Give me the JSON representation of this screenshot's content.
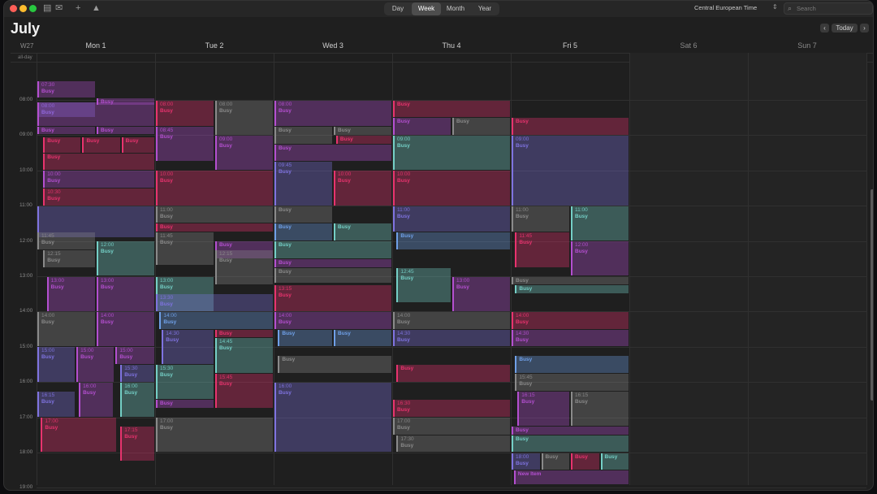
{
  "toolbar": {
    "views": [
      "Day",
      "Week",
      "Month",
      "Year"
    ],
    "selected_view": "Week",
    "timezone": "Central European Time",
    "search_placeholder": "Search"
  },
  "header": {
    "month": "July",
    "week_label": "W27",
    "today_label": "Today",
    "allday_label": "all-day",
    "days": [
      "Mon 1",
      "Tue 2",
      "Wed 3",
      "Thu 4",
      "Fri 5",
      "Sat 6",
      "Sun 7"
    ]
  },
  "hours": [
    "08:00",
    "09:00",
    "10:00",
    "11:00",
    "12:00",
    "13:00",
    "14:00",
    "15:00",
    "16:00",
    "17:00",
    "18:00",
    "19:00"
  ],
  "colors": {
    "purple": "#b44fd0",
    "pink": "#e8336e",
    "gray": "#8a8a8a",
    "lavender": "#7f73e0",
    "teal": "#74cfc6",
    "blue": "#6fa0e8"
  },
  "events": [
    {
      "col": 0,
      "x": 0,
      "w": 0.5,
      "s": 7.45,
      "e": 7.95,
      "c": "purple",
      "time": "07:30",
      "label": "Busy"
    },
    {
      "col": 0,
      "x": 0.5,
      "w": 0.5,
      "s": 7.95,
      "e": 8.15,
      "c": "purple",
      "time": "",
      "label": "Busy"
    },
    {
      "col": 0,
      "x": 0,
      "w": 0.5,
      "s": 8.05,
      "e": 8.5,
      "c": "lavender",
      "time": "08:00",
      "label": "Busy"
    },
    {
      "col": 0,
      "x": 0,
      "w": 1,
      "s": 8.05,
      "e": 8.75,
      "c": "purple",
      "time": "",
      "label": ""
    },
    {
      "col": 0,
      "x": 0,
      "w": 0.5,
      "s": 8.75,
      "e": 8.98,
      "c": "purple",
      "time": "",
      "label": "Busy"
    },
    {
      "col": 0,
      "x": 0.5,
      "w": 0.5,
      "s": 8.75,
      "e": 8.98,
      "c": "purple",
      "time": "",
      "label": "Busy"
    },
    {
      "col": 0,
      "x": 0.05,
      "w": 0.33,
      "s": 9.05,
      "e": 9.5,
      "c": "pink",
      "time": "",
      "label": "Busy"
    },
    {
      "col": 0,
      "x": 0.38,
      "w": 0.33,
      "s": 9.05,
      "e": 9.5,
      "c": "pink",
      "time": "",
      "label": "Busy"
    },
    {
      "col": 0,
      "x": 0.71,
      "w": 0.29,
      "s": 9.05,
      "e": 9.5,
      "c": "pink",
      "time": "",
      "label": "Busy"
    },
    {
      "col": 0,
      "x": 0.05,
      "w": 0.95,
      "s": 9.5,
      "e": 10.0,
      "c": "pink",
      "time": "",
      "label": "Busy"
    },
    {
      "col": 0,
      "x": 0.05,
      "w": 0.95,
      "s": 10.0,
      "e": 10.5,
      "c": "purple",
      "time": "10:00",
      "label": "Busy"
    },
    {
      "col": 0,
      "x": 0.05,
      "w": 0.95,
      "s": 10.5,
      "e": 11.0,
      "c": "pink",
      "time": "10:30",
      "label": "Busy"
    },
    {
      "col": 0,
      "x": 0,
      "w": 1,
      "s": 11.0,
      "e": 11.9,
      "c": "lavender",
      "time": "",
      "label": ""
    },
    {
      "col": 0,
      "x": 0,
      "w": 0.5,
      "s": 11.75,
      "e": 12.25,
      "c": "gray",
      "time": "11:45",
      "label": "Busy"
    },
    {
      "col": 0,
      "x": 0.05,
      "w": 0.45,
      "s": 12.25,
      "e": 12.75,
      "c": "gray",
      "time": "12:15",
      "label": "Busy"
    },
    {
      "col": 0,
      "x": 0.5,
      "w": 0.5,
      "s": 12.0,
      "e": 13.0,
      "c": "teal",
      "time": "12:00",
      "label": "Busy"
    },
    {
      "col": 0,
      "x": 0.08,
      "w": 0.42,
      "s": 13.0,
      "e": 14.0,
      "c": "purple",
      "time": "13:00",
      "label": "Busy"
    },
    {
      "col": 0,
      "x": 0.5,
      "w": 0.5,
      "s": 13.0,
      "e": 14.0,
      "c": "purple",
      "time": "13:00",
      "label": "Busy"
    },
    {
      "col": 0,
      "x": 0,
      "w": 0.5,
      "s": 14.0,
      "e": 15.0,
      "c": "gray",
      "time": "14:00",
      "label": "Busy"
    },
    {
      "col": 0,
      "x": 0.5,
      "w": 0.5,
      "s": 14.0,
      "e": 15.0,
      "c": "purple",
      "time": "14:00",
      "label": "Busy"
    },
    {
      "col": 0,
      "x": 0,
      "w": 0.33,
      "s": 15.0,
      "e": 16.0,
      "c": "lavender",
      "time": "15:00",
      "label": "Busy"
    },
    {
      "col": 0,
      "x": 0.33,
      "w": 0.33,
      "s": 15.0,
      "e": 16.0,
      "c": "purple",
      "time": "15:00",
      "label": "Busy"
    },
    {
      "col": 0,
      "x": 0.66,
      "w": 0.34,
      "s": 15.0,
      "e": 15.5,
      "c": "purple",
      "time": "15:00",
      "label": "Busy"
    },
    {
      "col": 0,
      "x": 0.7,
      "w": 0.3,
      "s": 15.5,
      "e": 16.0,
      "c": "lavender",
      "time": "15:30",
      "label": "Busy"
    },
    {
      "col": 0,
      "x": 0,
      "w": 0.33,
      "s": 16.25,
      "e": 17.0,
      "c": "lavender",
      "time": "16:15",
      "label": "Busy"
    },
    {
      "col": 0,
      "x": 0.35,
      "w": 0.3,
      "s": 16.0,
      "e": 17.0,
      "c": "purple",
      "time": "16:00",
      "label": "Busy"
    },
    {
      "col": 0,
      "x": 0.7,
      "w": 0.3,
      "s": 16.0,
      "e": 17.0,
      "c": "teal",
      "time": "16:00",
      "label": "Busy"
    },
    {
      "col": 0,
      "x": 0.03,
      "w": 0.65,
      "s": 17.0,
      "e": 18.0,
      "c": "pink",
      "time": "17:00",
      "label": "Busy"
    },
    {
      "col": 0,
      "x": 0.7,
      "w": 0.3,
      "s": 17.25,
      "e": 18.25,
      "c": "pink",
      "time": "17:15",
      "label": "Busy"
    },
    {
      "col": 1,
      "x": 0,
      "w": 0.5,
      "s": 8.0,
      "e": 8.75,
      "c": "pink",
      "time": "08:00",
      "label": "Busy"
    },
    {
      "col": 1,
      "x": 0.5,
      "w": 0.5,
      "s": 8.0,
      "e": 9.0,
      "c": "gray",
      "time": "08:00",
      "label": "Busy"
    },
    {
      "col": 1,
      "x": 0,
      "w": 0.5,
      "s": 8.75,
      "e": 9.75,
      "c": "purple",
      "time": "08:45",
      "label": "Busy"
    },
    {
      "col": 1,
      "x": 0.5,
      "w": 0.5,
      "s": 9.0,
      "e": 10.0,
      "c": "purple",
      "time": "09:00",
      "label": "Busy"
    },
    {
      "col": 1,
      "x": 0,
      "w": 1,
      "s": 10.0,
      "e": 11.0,
      "c": "pink",
      "time": "10:00",
      "label": "Busy"
    },
    {
      "col": 1,
      "x": 0,
      "w": 1,
      "s": 11.0,
      "e": 11.5,
      "c": "gray",
      "time": "11:00",
      "label": "Busy"
    },
    {
      "col": 1,
      "x": 0,
      "w": 1,
      "s": 11.5,
      "e": 11.75,
      "c": "pink",
      "time": "",
      "label": "Busy"
    },
    {
      "col": 1,
      "x": 0,
      "w": 0.5,
      "s": 11.75,
      "e": 12.7,
      "c": "gray",
      "time": "11:45",
      "label": "Busy"
    },
    {
      "col": 1,
      "x": 0.5,
      "w": 0.5,
      "s": 12.0,
      "e": 12.5,
      "c": "purple",
      "time": "",
      "label": "Busy"
    },
    {
      "col": 1,
      "x": 0.5,
      "w": 0.5,
      "s": 12.25,
      "e": 13.25,
      "c": "gray",
      "time": "12:15",
      "label": "Busy"
    },
    {
      "col": 1,
      "x": 0,
      "w": 0.5,
      "s": 13.0,
      "e": 14.0,
      "c": "teal",
      "time": "13:00",
      "label": "Busy"
    },
    {
      "col": 1,
      "x": 0,
      "w": 1,
      "s": 13.5,
      "e": 14.0,
      "c": "lavender",
      "time": "13:30",
      "label": "Busy"
    },
    {
      "col": 1,
      "x": 0.03,
      "w": 0.97,
      "s": 14.0,
      "e": 14.5,
      "c": "blue",
      "time": "14:00",
      "label": "Busy"
    },
    {
      "col": 1,
      "x": 0.05,
      "w": 0.45,
      "s": 14.5,
      "e": 15.5,
      "c": "lavender",
      "time": "14:30",
      "label": "Busy"
    },
    {
      "col": 1,
      "x": 0.5,
      "w": 0.5,
      "s": 14.5,
      "e": 14.75,
      "c": "pink",
      "time": "",
      "label": "Busy"
    },
    {
      "col": 1,
      "x": 0.5,
      "w": 0.5,
      "s": 14.75,
      "e": 15.75,
      "c": "teal",
      "time": "14:45",
      "label": "Busy"
    },
    {
      "col": 1,
      "x": 0,
      "w": 0.5,
      "s": 15.5,
      "e": 16.5,
      "c": "teal",
      "time": "15:30",
      "label": "Busy"
    },
    {
      "col": 1,
      "x": 0.5,
      "w": 0.5,
      "s": 15.75,
      "e": 16.75,
      "c": "pink",
      "time": "15:45",
      "label": "Busy"
    },
    {
      "col": 1,
      "x": 0,
      "w": 0.5,
      "s": 16.5,
      "e": 16.75,
      "c": "purple",
      "time": "",
      "label": "Busy"
    },
    {
      "col": 1,
      "x": 0,
      "w": 1,
      "s": 17.0,
      "e": 18.0,
      "c": "gray",
      "time": "17:00",
      "label": "Busy"
    },
    {
      "col": 2,
      "x": 0,
      "w": 1,
      "s": 8.0,
      "e": 8.75,
      "c": "purple",
      "time": "08:00",
      "label": "Busy"
    },
    {
      "col": 2,
      "x": 0,
      "w": 0.5,
      "s": 8.75,
      "e": 9.25,
      "c": "gray",
      "time": "",
      "label": "Busy"
    },
    {
      "col": 2,
      "x": 0.5,
      "w": 0.5,
      "s": 8.75,
      "e": 9.0,
      "c": "gray",
      "time": "",
      "label": "Busy"
    },
    {
      "col": 2,
      "x": 0.52,
      "w": 0.48,
      "s": 9.0,
      "e": 9.25,
      "c": "pink",
      "time": "",
      "label": "Busy"
    },
    {
      "col": 2,
      "x": 0,
      "w": 1,
      "s": 9.25,
      "e": 9.75,
      "c": "purple",
      "time": "",
      "label": "Busy"
    },
    {
      "col": 2,
      "x": 0,
      "w": 0.5,
      "s": 9.75,
      "e": 11.0,
      "c": "lavender",
      "time": "09:45",
      "label": "Busy"
    },
    {
      "col": 2,
      "x": 0.5,
      "w": 0.5,
      "s": 10.0,
      "e": 11.0,
      "c": "pink",
      "time": "10:00",
      "label": "Busy"
    },
    {
      "col": 2,
      "x": 0,
      "w": 0.5,
      "s": 11.0,
      "e": 11.5,
      "c": "gray",
      "time": "",
      "label": "Busy"
    },
    {
      "col": 2,
      "x": 0,
      "w": 0.5,
      "s": 11.5,
      "e": 12.0,
      "c": "blue",
      "time": "",
      "label": "Busy"
    },
    {
      "col": 2,
      "x": 0.5,
      "w": 0.5,
      "s": 11.5,
      "e": 12.0,
      "c": "teal",
      "time": "",
      "label": "Busy"
    },
    {
      "col": 2,
      "x": 0,
      "w": 1,
      "s": 12.0,
      "e": 12.5,
      "c": "teal",
      "time": "",
      "label": "Busy"
    },
    {
      "col": 2,
      "x": 0,
      "w": 1,
      "s": 12.5,
      "e": 12.75,
      "c": "purple",
      "time": "",
      "label": "Busy"
    },
    {
      "col": 2,
      "x": 0,
      "w": 1,
      "s": 12.75,
      "e": 13.2,
      "c": "gray",
      "time": "",
      "label": "Busy"
    },
    {
      "col": 2,
      "x": 0,
      "w": 1,
      "s": 13.25,
      "e": 14.0,
      "c": "pink",
      "time": "13:15",
      "label": "Busy"
    },
    {
      "col": 2,
      "x": 0,
      "w": 1,
      "s": 14.0,
      "e": 14.5,
      "c": "purple",
      "time": "14:00",
      "label": "Busy"
    },
    {
      "col": 2,
      "x": 0.03,
      "w": 0.47,
      "s": 14.5,
      "e": 15.0,
      "c": "blue",
      "time": "",
      "label": "Busy"
    },
    {
      "col": 2,
      "x": 0.5,
      "w": 0.5,
      "s": 14.5,
      "e": 15.0,
      "c": "blue",
      "time": "",
      "label": "Busy"
    },
    {
      "col": 2,
      "x": 0.03,
      "w": 0.97,
      "s": 15.25,
      "e": 15.75,
      "c": "gray",
      "time": "",
      "label": "Busy"
    },
    {
      "col": 2,
      "x": 0,
      "w": 1,
      "s": 16.0,
      "e": 18.0,
      "c": "lavender",
      "time": "16:00",
      "label": "Busy"
    },
    {
      "col": 3,
      "x": 0,
      "w": 1,
      "s": 8.0,
      "e": 8.5,
      "c": "pink",
      "time": "",
      "label": "Busy"
    },
    {
      "col": 3,
      "x": 0,
      "w": 0.5,
      "s": 8.5,
      "e": 9.0,
      "c": "purple",
      "time": "",
      "label": "Busy"
    },
    {
      "col": 3,
      "x": 0.5,
      "w": 0.5,
      "s": 8.5,
      "e": 9.0,
      "c": "gray",
      "time": "",
      "label": "Busy"
    },
    {
      "col": 3,
      "x": 0,
      "w": 1,
      "s": 9.0,
      "e": 10.0,
      "c": "teal",
      "time": "09:00",
      "label": "Busy"
    },
    {
      "col": 3,
      "x": 0,
      "w": 1,
      "s": 10.0,
      "e": 11.0,
      "c": "pink",
      "time": "10:00",
      "label": "Busy"
    },
    {
      "col": 3,
      "x": 0,
      "w": 1,
      "s": 11.0,
      "e": 11.75,
      "c": "lavender",
      "time": "11:00",
      "label": "Busy"
    },
    {
      "col": 3,
      "x": 0.03,
      "w": 0.97,
      "s": 11.75,
      "e": 12.25,
      "c": "blue",
      "time": "",
      "label": "Busy"
    },
    {
      "col": 3,
      "x": 0.03,
      "w": 0.47,
      "s": 12.75,
      "e": 13.75,
      "c": "teal",
      "time": "12:45",
      "label": "Busy"
    },
    {
      "col": 3,
      "x": 0.5,
      "w": 0.5,
      "s": 13.0,
      "e": 14.0,
      "c": "purple",
      "time": "13:00",
      "label": "Busy"
    },
    {
      "col": 3,
      "x": 0,
      "w": 1,
      "s": 14.0,
      "e": 14.5,
      "c": "gray",
      "time": "14:00",
      "label": "Busy"
    },
    {
      "col": 3,
      "x": 0,
      "w": 1,
      "s": 14.5,
      "e": 15.0,
      "c": "lavender",
      "time": "14:30",
      "label": "Busy"
    },
    {
      "col": 3,
      "x": 0.03,
      "w": 0.97,
      "s": 15.5,
      "e": 16.0,
      "c": "pink",
      "time": "",
      "label": "Busy"
    },
    {
      "col": 3,
      "x": 0,
      "w": 1,
      "s": 16.5,
      "e": 17.0,
      "c": "pink",
      "time": "16:30",
      "label": "Busy"
    },
    {
      "col": 3,
      "x": 0,
      "w": 1,
      "s": 17.0,
      "e": 17.5,
      "c": "gray",
      "time": "17:00",
      "label": "Busy"
    },
    {
      "col": 3,
      "x": 0.03,
      "w": 0.97,
      "s": 17.5,
      "e": 18.0,
      "c": "gray",
      "time": "17:30",
      "label": "Busy"
    },
    {
      "col": 4,
      "x": 0,
      "w": 1,
      "s": 8.5,
      "e": 9.0,
      "c": "pink",
      "time": "",
      "label": "Busy"
    },
    {
      "col": 4,
      "x": 0,
      "w": 1,
      "s": 9.0,
      "e": 11.0,
      "c": "lavender",
      "time": "09:00",
      "label": "Busy"
    },
    {
      "col": 4,
      "x": 0,
      "w": 0.5,
      "s": 11.0,
      "e": 11.75,
      "c": "gray",
      "time": "11:00",
      "label": "Busy"
    },
    {
      "col": 4,
      "x": 0.5,
      "w": 0.5,
      "s": 11.0,
      "e": 12.0,
      "c": "teal",
      "time": "11:00",
      "label": "Busy"
    },
    {
      "col": 4,
      "x": 0.03,
      "w": 0.47,
      "s": 11.75,
      "e": 12.75,
      "c": "pink",
      "time": "11:45",
      "label": "Busy"
    },
    {
      "col": 4,
      "x": 0.5,
      "w": 0.5,
      "s": 12.0,
      "e": 13.0,
      "c": "purple",
      "time": "12:00",
      "label": "Busy"
    },
    {
      "col": 4,
      "x": 0,
      "w": 1,
      "s": 13.0,
      "e": 13.25,
      "c": "gray",
      "time": "",
      "label": "Busy"
    },
    {
      "col": 4,
      "x": 0.03,
      "w": 0.97,
      "s": 13.25,
      "e": 13.5,
      "c": "teal",
      "time": "",
      "label": "Busy"
    },
    {
      "col": 4,
      "x": 0,
      "w": 1,
      "s": 14.0,
      "e": 14.5,
      "c": "pink",
      "time": "14:00",
      "label": "Busy"
    },
    {
      "col": 4,
      "x": 0,
      "w": 1,
      "s": 14.5,
      "e": 15.0,
      "c": "purple",
      "time": "14:30",
      "label": "Busy"
    },
    {
      "col": 4,
      "x": 0.03,
      "w": 0.97,
      "s": 15.25,
      "e": 15.75,
      "c": "blue",
      "time": "",
      "label": "Busy"
    },
    {
      "col": 4,
      "x": 0.03,
      "w": 0.97,
      "s": 15.75,
      "e": 16.25,
      "c": "gray",
      "time": "15:45",
      "label": "Busy"
    },
    {
      "col": 4,
      "x": 0.05,
      "w": 0.45,
      "s": 16.25,
      "e": 17.25,
      "c": "purple",
      "time": "16:15",
      "label": "Busy"
    },
    {
      "col": 4,
      "x": 0.5,
      "w": 0.5,
      "s": 16.25,
      "e": 17.25,
      "c": "gray",
      "time": "16:15",
      "label": "Busy"
    },
    {
      "col": 4,
      "x": 0,
      "w": 1,
      "s": 17.25,
      "e": 17.5,
      "c": "purple",
      "time": "",
      "label": "Busy"
    },
    {
      "col": 4,
      "x": 0,
      "w": 1,
      "s": 17.5,
      "e": 18.0,
      "c": "teal",
      "time": "",
      "label": "Busy"
    },
    {
      "col": 4,
      "x": 0,
      "w": 0.25,
      "s": 18.0,
      "e": 18.5,
      "c": "lavender",
      "time": "18:00",
      "label": "Busy"
    },
    {
      "col": 4,
      "x": 0.25,
      "w": 0.25,
      "s": 18.0,
      "e": 18.5,
      "c": "gray",
      "time": "",
      "label": "Busy"
    },
    {
      "col": 4,
      "x": 0.5,
      "w": 0.25,
      "s": 18.0,
      "e": 18.5,
      "c": "pink",
      "time": "",
      "label": "Busy"
    },
    {
      "col": 4,
      "x": 0.75,
      "w": 0.25,
      "s": 18.0,
      "e": 18.5,
      "c": "teal",
      "time": "",
      "label": "Busy"
    },
    {
      "col": 4,
      "x": 0.02,
      "w": 0.98,
      "s": 18.5,
      "e": 19.0,
      "c": "purple",
      "time": "",
      "label": "New Item"
    }
  ]
}
